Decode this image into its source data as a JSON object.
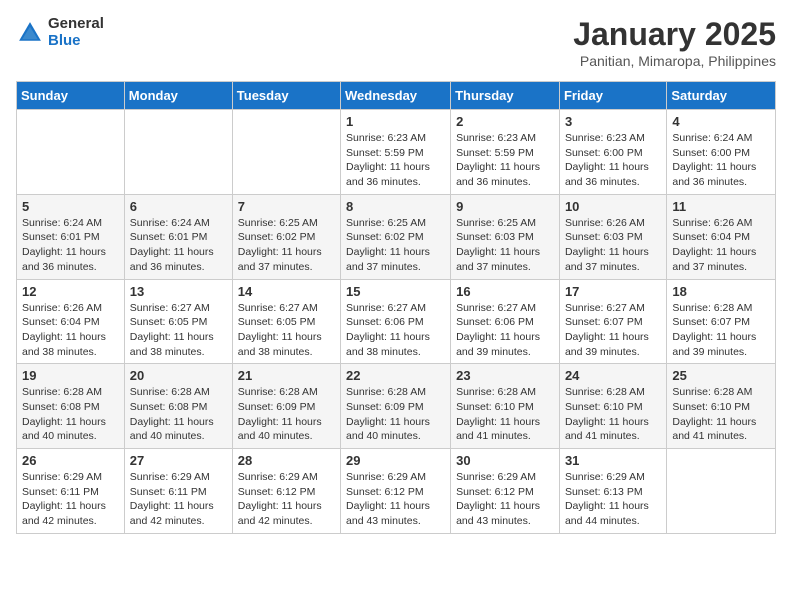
{
  "logo": {
    "general": "General",
    "blue": "Blue"
  },
  "header": {
    "month": "January 2025",
    "location": "Panitian, Mimaropa, Philippines"
  },
  "weekdays": [
    "Sunday",
    "Monday",
    "Tuesday",
    "Wednesday",
    "Thursday",
    "Friday",
    "Saturday"
  ],
  "weeks": [
    [
      {
        "day": "",
        "sunrise": "",
        "sunset": "",
        "daylight": ""
      },
      {
        "day": "",
        "sunrise": "",
        "sunset": "",
        "daylight": ""
      },
      {
        "day": "",
        "sunrise": "",
        "sunset": "",
        "daylight": ""
      },
      {
        "day": "1",
        "sunrise": "Sunrise: 6:23 AM",
        "sunset": "Sunset: 5:59 PM",
        "daylight": "Daylight: 11 hours and 36 minutes."
      },
      {
        "day": "2",
        "sunrise": "Sunrise: 6:23 AM",
        "sunset": "Sunset: 5:59 PM",
        "daylight": "Daylight: 11 hours and 36 minutes."
      },
      {
        "day": "3",
        "sunrise": "Sunrise: 6:23 AM",
        "sunset": "Sunset: 6:00 PM",
        "daylight": "Daylight: 11 hours and 36 minutes."
      },
      {
        "day": "4",
        "sunrise": "Sunrise: 6:24 AM",
        "sunset": "Sunset: 6:00 PM",
        "daylight": "Daylight: 11 hours and 36 minutes."
      }
    ],
    [
      {
        "day": "5",
        "sunrise": "Sunrise: 6:24 AM",
        "sunset": "Sunset: 6:01 PM",
        "daylight": "Daylight: 11 hours and 36 minutes."
      },
      {
        "day": "6",
        "sunrise": "Sunrise: 6:24 AM",
        "sunset": "Sunset: 6:01 PM",
        "daylight": "Daylight: 11 hours and 36 minutes."
      },
      {
        "day": "7",
        "sunrise": "Sunrise: 6:25 AM",
        "sunset": "Sunset: 6:02 PM",
        "daylight": "Daylight: 11 hours and 37 minutes."
      },
      {
        "day": "8",
        "sunrise": "Sunrise: 6:25 AM",
        "sunset": "Sunset: 6:02 PM",
        "daylight": "Daylight: 11 hours and 37 minutes."
      },
      {
        "day": "9",
        "sunrise": "Sunrise: 6:25 AM",
        "sunset": "Sunset: 6:03 PM",
        "daylight": "Daylight: 11 hours and 37 minutes."
      },
      {
        "day": "10",
        "sunrise": "Sunrise: 6:26 AM",
        "sunset": "Sunset: 6:03 PM",
        "daylight": "Daylight: 11 hours and 37 minutes."
      },
      {
        "day": "11",
        "sunrise": "Sunrise: 6:26 AM",
        "sunset": "Sunset: 6:04 PM",
        "daylight": "Daylight: 11 hours and 37 minutes."
      }
    ],
    [
      {
        "day": "12",
        "sunrise": "Sunrise: 6:26 AM",
        "sunset": "Sunset: 6:04 PM",
        "daylight": "Daylight: 11 hours and 38 minutes."
      },
      {
        "day": "13",
        "sunrise": "Sunrise: 6:27 AM",
        "sunset": "Sunset: 6:05 PM",
        "daylight": "Daylight: 11 hours and 38 minutes."
      },
      {
        "day": "14",
        "sunrise": "Sunrise: 6:27 AM",
        "sunset": "Sunset: 6:05 PM",
        "daylight": "Daylight: 11 hours and 38 minutes."
      },
      {
        "day": "15",
        "sunrise": "Sunrise: 6:27 AM",
        "sunset": "Sunset: 6:06 PM",
        "daylight": "Daylight: 11 hours and 38 minutes."
      },
      {
        "day": "16",
        "sunrise": "Sunrise: 6:27 AM",
        "sunset": "Sunset: 6:06 PM",
        "daylight": "Daylight: 11 hours and 39 minutes."
      },
      {
        "day": "17",
        "sunrise": "Sunrise: 6:27 AM",
        "sunset": "Sunset: 6:07 PM",
        "daylight": "Daylight: 11 hours and 39 minutes."
      },
      {
        "day": "18",
        "sunrise": "Sunrise: 6:28 AM",
        "sunset": "Sunset: 6:07 PM",
        "daylight": "Daylight: 11 hours and 39 minutes."
      }
    ],
    [
      {
        "day": "19",
        "sunrise": "Sunrise: 6:28 AM",
        "sunset": "Sunset: 6:08 PM",
        "daylight": "Daylight: 11 hours and 40 minutes."
      },
      {
        "day": "20",
        "sunrise": "Sunrise: 6:28 AM",
        "sunset": "Sunset: 6:08 PM",
        "daylight": "Daylight: 11 hours and 40 minutes."
      },
      {
        "day": "21",
        "sunrise": "Sunrise: 6:28 AM",
        "sunset": "Sunset: 6:09 PM",
        "daylight": "Daylight: 11 hours and 40 minutes."
      },
      {
        "day": "22",
        "sunrise": "Sunrise: 6:28 AM",
        "sunset": "Sunset: 6:09 PM",
        "daylight": "Daylight: 11 hours and 40 minutes."
      },
      {
        "day": "23",
        "sunrise": "Sunrise: 6:28 AM",
        "sunset": "Sunset: 6:10 PM",
        "daylight": "Daylight: 11 hours and 41 minutes."
      },
      {
        "day": "24",
        "sunrise": "Sunrise: 6:28 AM",
        "sunset": "Sunset: 6:10 PM",
        "daylight": "Daylight: 11 hours and 41 minutes."
      },
      {
        "day": "25",
        "sunrise": "Sunrise: 6:28 AM",
        "sunset": "Sunset: 6:10 PM",
        "daylight": "Daylight: 11 hours and 41 minutes."
      }
    ],
    [
      {
        "day": "26",
        "sunrise": "Sunrise: 6:29 AM",
        "sunset": "Sunset: 6:11 PM",
        "daylight": "Daylight: 11 hours and 42 minutes."
      },
      {
        "day": "27",
        "sunrise": "Sunrise: 6:29 AM",
        "sunset": "Sunset: 6:11 PM",
        "daylight": "Daylight: 11 hours and 42 minutes."
      },
      {
        "day": "28",
        "sunrise": "Sunrise: 6:29 AM",
        "sunset": "Sunset: 6:12 PM",
        "daylight": "Daylight: 11 hours and 42 minutes."
      },
      {
        "day": "29",
        "sunrise": "Sunrise: 6:29 AM",
        "sunset": "Sunset: 6:12 PM",
        "daylight": "Daylight: 11 hours and 43 minutes."
      },
      {
        "day": "30",
        "sunrise": "Sunrise: 6:29 AM",
        "sunset": "Sunset: 6:12 PM",
        "daylight": "Daylight: 11 hours and 43 minutes."
      },
      {
        "day": "31",
        "sunrise": "Sunrise: 6:29 AM",
        "sunset": "Sunset: 6:13 PM",
        "daylight": "Daylight: 11 hours and 44 minutes."
      },
      {
        "day": "",
        "sunrise": "",
        "sunset": "",
        "daylight": ""
      }
    ]
  ]
}
